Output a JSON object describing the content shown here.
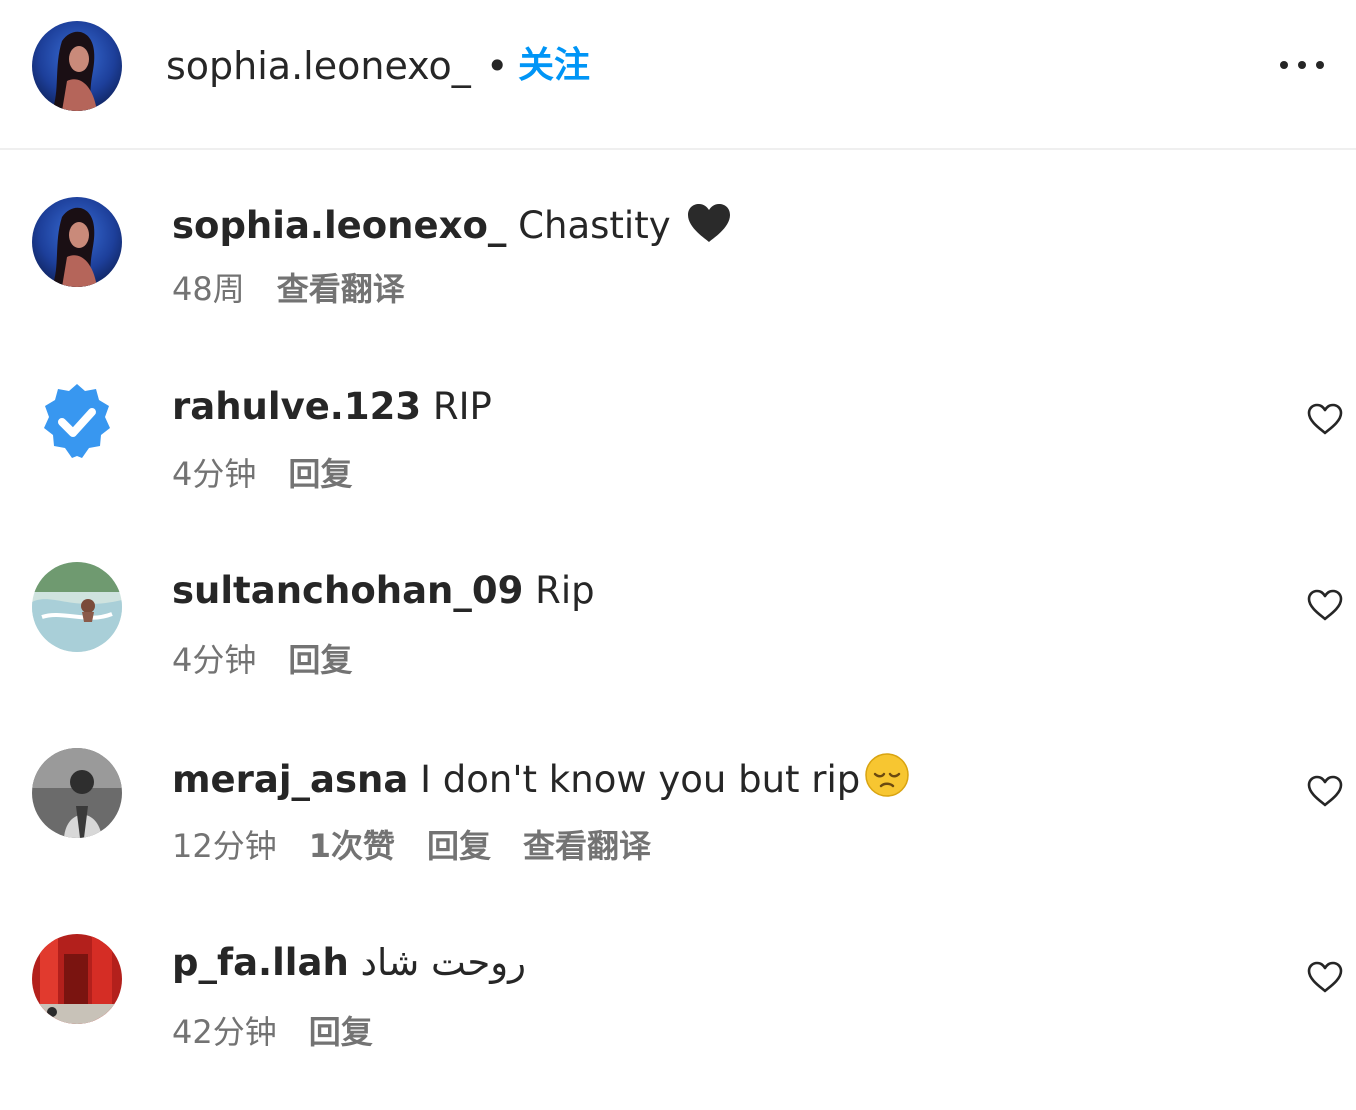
{
  "header": {
    "username": "sophia.leonexo_",
    "separator": "•",
    "follow_label": "关注",
    "more_icon": "more-horizontal-icon"
  },
  "comments": [
    {
      "username": "sophia.leonexo_",
      "text": "Chastity",
      "emoji": "black-heart-icon",
      "time": "48周",
      "actions": [
        "查看翻译"
      ],
      "has_like": false
    },
    {
      "username": "rahulve.123",
      "text": "RIP",
      "time": "4分钟",
      "actions": [
        "回复"
      ],
      "has_like": true
    },
    {
      "username": "sultanchohan_09",
      "text": "Rip",
      "time": "4分钟",
      "actions": [
        "回复"
      ],
      "has_like": true
    },
    {
      "username": "meraj_asna",
      "text": "I don't know you but rip",
      "emoji": "pensive-face-icon",
      "time": "12分钟",
      "actions": [
        "1次赞",
        "回复",
        "查看翻译"
      ],
      "has_like": true
    },
    {
      "username": "p_fa.llah",
      "text": "روحت شاد",
      "time": "42分钟",
      "actions": [
        "回复"
      ],
      "has_like": true
    }
  ],
  "colors": {
    "accent": "#0095f6",
    "text": "#262626",
    "secondary": "#737373",
    "verified_badge": "#3897f0"
  }
}
